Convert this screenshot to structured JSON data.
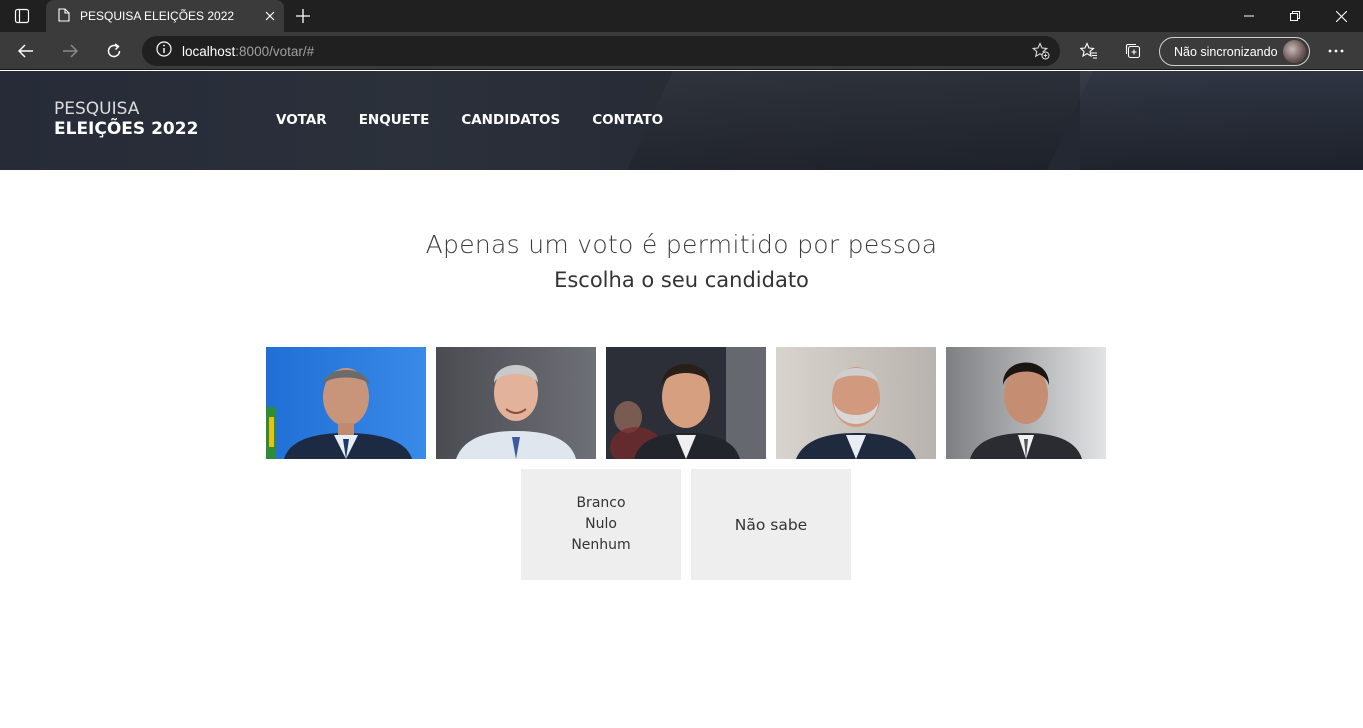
{
  "browser": {
    "tab_title": "PESQUISA ELEIÇÕES 2022",
    "url_host": "localhost",
    "url_path": ":8000/votar/#",
    "profile_label": "Não sincronizando"
  },
  "site": {
    "logo_line1": "PESQUISA",
    "logo_line2": "ELEIÇÕES 2022",
    "nav": [
      "VOTAR",
      "ENQUETE",
      "CANDIDATOS",
      "CONTATO"
    ]
  },
  "main": {
    "heading": "Apenas um voto é permitido por pessoa",
    "subheading": "Escolha o seu candidato",
    "options": {
      "blank_lines": [
        "Branco",
        "Nulo",
        "Nenhum"
      ],
      "dont_know": "Não sabe"
    }
  },
  "colors": {
    "header_bg": "#262b37",
    "option_bg": "#eeeeee",
    "browser_dark": "#202020",
    "browser_toolbar": "#3b3b3b"
  }
}
